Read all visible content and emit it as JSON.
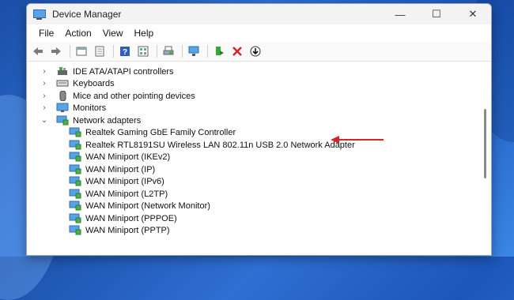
{
  "window": {
    "title": "Device Manager"
  },
  "controls": {
    "minimize": "—",
    "maximize": "☐",
    "close": "✕"
  },
  "menu": [
    "File",
    "Action",
    "View",
    "Help"
  ],
  "toolbar": [
    "back-arrow-icon",
    "forward-arrow-icon",
    "properties-icon",
    "show-hidden-icon",
    "help-icon",
    "details-icon",
    "print-icon",
    "scan-hardware-icon",
    "update-driver-icon",
    "uninstall-icon",
    "disable-device-icon"
  ],
  "tree": {
    "categories": [
      {
        "label": "IDE ATA/ATAPI controllers",
        "expanded": false
      },
      {
        "label": "Keyboards",
        "expanded": false
      },
      {
        "label": "Mice and other pointing devices",
        "expanded": false
      },
      {
        "label": "Monitors",
        "expanded": false
      },
      {
        "label": "Network adapters",
        "expanded": true
      }
    ],
    "adapters": [
      "Realtek Gaming GbE Family Controller",
      "Realtek RTL8191SU Wireless LAN 802.11n USB 2.0 Network Adapter",
      "WAN Miniport (IKEv2)",
      "WAN Miniport (IP)",
      "WAN Miniport (IPv6)",
      "WAN Miniport (L2TP)",
      "WAN Miniport (Network Monitor)",
      "WAN Miniport (PPPOE)",
      "WAN Miniport (PPTP)"
    ]
  },
  "colors": {
    "arrow": "#d3262b",
    "accent": "#2f6fd3"
  }
}
